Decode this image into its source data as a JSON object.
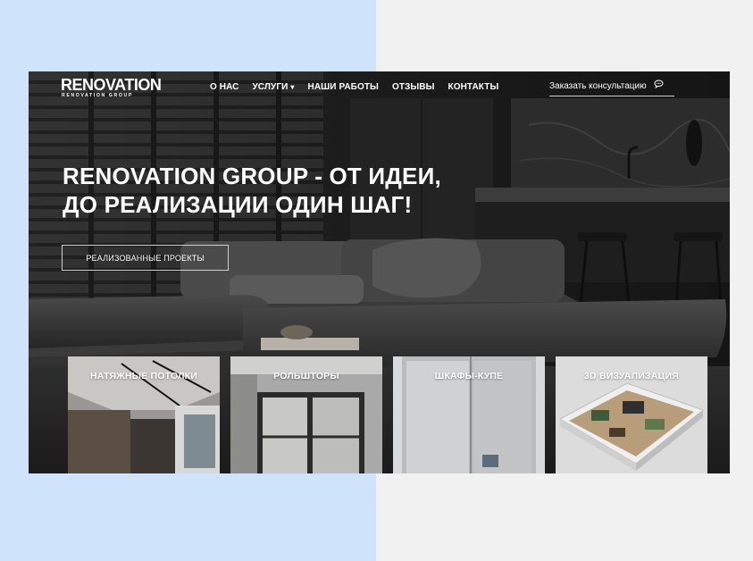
{
  "logo": {
    "main": "RENOVATION",
    "sub": "RENOVATION GROUP"
  },
  "nav": {
    "items": [
      {
        "label": "О НАС"
      },
      {
        "label": "УСЛУГИ",
        "has_dropdown": true
      },
      {
        "label": "НАШИ РАБОТЫ"
      },
      {
        "label": "ОТЗЫВЫ"
      },
      {
        "label": "КОНТАКТЫ"
      }
    ]
  },
  "consult": {
    "label": "Заказать консультацию",
    "icon": "chat-bubble-icon"
  },
  "hero": {
    "headline_line1": "RENOVATION GROUP - ОТ ИДЕИ,",
    "headline_line2": "ДО РЕАЛИЗАЦИИ ОДИН ШАГ!",
    "button_label": "РЕАЛИЗОВАННЫЕ ПРОЕКТЫ"
  },
  "services": [
    {
      "title": "НАТЯЖНЫЕ ПОТОЛКИ"
    },
    {
      "title": "РОЛЬШТОРЫ"
    },
    {
      "title": "ШКАФЫ-КУПЕ"
    },
    {
      "title": "3D ВИЗУАЛИЗАЦИЯ"
    }
  ],
  "colors": {
    "page_left": "#cfe3fb",
    "page_right": "#f1f1f1",
    "hero_dark": "#1a1a1a",
    "text": "#ffffff"
  }
}
